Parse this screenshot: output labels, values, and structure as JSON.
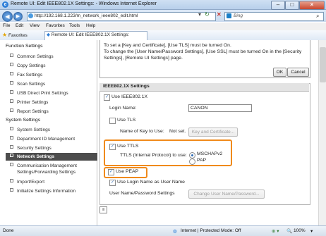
{
  "window": {
    "title": "Remote UI: Edit IEEE802.1X Settings:",
    "title_suffix": " - Windows Internet Explorer",
    "btn_min": "–",
    "btn_max": "□",
    "btn_close": "×"
  },
  "address": {
    "url": "http://192.168.1.223/m_network_ieee802_edit.html",
    "search_placeholder": "Bing",
    "refresh_icon": "↻",
    "stop_icon": "✕",
    "search_icon": "⌕"
  },
  "menu": [
    "File",
    "Edit",
    "View",
    "Favorites",
    "Tools",
    "Help"
  ],
  "favorites": {
    "label": "Favorites",
    "tab_title": "Remote UI: Edit IEEE802.1X Settings:"
  },
  "sidebar": {
    "function_settings_header": "Function Settings",
    "function_items": [
      "Common Settings",
      "Copy Settings",
      "Fax Settings",
      "Scan Settings",
      "USB Direct Print Settings",
      "Printer Settings",
      "Report Settings"
    ],
    "system_settings_header": "System Settings",
    "system_items": [
      "System Settings",
      "Department ID Management",
      "Security Settings",
      "Network Settings",
      "Communication Management Settings/Forwarding Settings",
      "Import/Export",
      "Initialize Settings Information"
    ],
    "comm_line1": "Communication Management",
    "comm_line2": "Settings/Forwarding Settings"
  },
  "message": {
    "line1": "To set a [Key and Certificate], [Use TLS] must be turned On.",
    "line2": "To change the [User Name/Password Settings], [Use SSL] must be turned On in the [Security",
    "line3": "Settings], [Remote UI Settings] page.",
    "ok": "OK",
    "cancel": "Cancel"
  },
  "ieee": {
    "header": "IEEE802.1X Settings",
    "use_ieee": "Use IEEE802.1X",
    "login_name_label": "Login Name:",
    "login_name_value": "CANON",
    "use_tls": "Use TLS",
    "key_to_use_label": "Name of Key to Use:",
    "key_to_use_value": "Not set.",
    "key_cert_button": "Key and Certificate...",
    "use_ttls": "Use TTLS",
    "ttls_protocol_label": "TTLS (Internal Protocol) to use:",
    "mschapv2": "MSCHAPv2",
    "pap": "PAP",
    "use_peap": "Use PEAP",
    "use_login_as_user": "Use Login Name as User Name",
    "user_pass_label": "User Name/Password Settings",
    "change_user_button": "Change User Name/Password..."
  },
  "status": {
    "left": "Done",
    "zone": "Internet | Protected Mode: Off",
    "zoom": "100%"
  },
  "colors": {
    "highlight": "#f08a1c",
    "active_nav": "#4d4d4d"
  }
}
